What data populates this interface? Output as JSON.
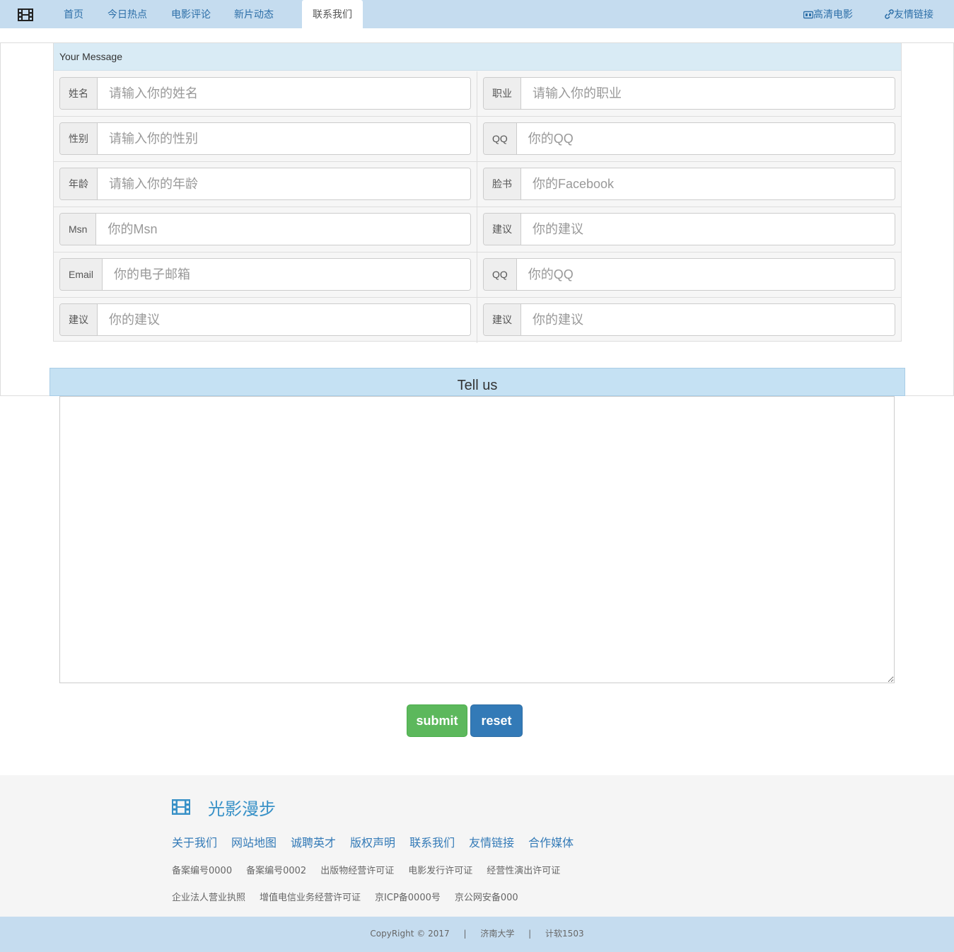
{
  "navbar": {
    "brand_icon": "film-icon",
    "items": [
      {
        "label": "首页"
      },
      {
        "label": "今日热点"
      },
      {
        "label": "电影评论"
      },
      {
        "label": "新片动态"
      },
      {
        "label": "联系我们",
        "active": true
      }
    ],
    "right": [
      {
        "label": "高清电影",
        "icon": "hd-video-icon"
      },
      {
        "label": "友情链接",
        "icon": "link-icon"
      }
    ]
  },
  "message_panel": {
    "heading": "Your Message",
    "rows": [
      {
        "left": {
          "label": "姓名",
          "placeholder": "请输入你的姓名"
        },
        "right": {
          "label": "职业",
          "placeholder": "请输入你的职业"
        }
      },
      {
        "left": {
          "label": "性别",
          "placeholder": "请输入你的性别"
        },
        "right": {
          "label": "QQ",
          "placeholder": "你的QQ"
        }
      },
      {
        "left": {
          "label": "年龄",
          "placeholder": "请输入你的年龄"
        },
        "right": {
          "label": "脸书",
          "placeholder": "你的Facebook"
        }
      },
      {
        "left": {
          "label": "Msn",
          "placeholder": "你的Msn"
        },
        "right": {
          "label": "建议",
          "placeholder": "你的建议"
        }
      },
      {
        "left": {
          "label": "Email",
          "placeholder": "你的电子邮箱"
        },
        "right": {
          "label": "QQ",
          "placeholder": "你的QQ"
        }
      },
      {
        "left": {
          "label": "建议",
          "placeholder": "你的建议"
        },
        "right": {
          "label": "建议",
          "placeholder": "你的建议"
        }
      }
    ]
  },
  "tell_us": {
    "heading": "Tell us",
    "value": ""
  },
  "buttons": {
    "submit": "submit",
    "reset": "reset"
  },
  "colors": {
    "navbar": "#c5dcef",
    "submit": "#5cb85c",
    "reset": "#337ab7",
    "link": "#337ab7"
  },
  "footer": {
    "logo_icon": "film-icon",
    "title": "光影漫步",
    "links": [
      "关于我们",
      "网站地图",
      "诚聘英才",
      "版权声明",
      "联系我们",
      "友情链接",
      "合作媒体"
    ],
    "row1": [
      "备案编号0000",
      "备案编号0002",
      "出版物经营许可证",
      "电影发行许可证",
      "经营性演出许可证"
    ],
    "row2": [
      "企业法人营业执照",
      "增值电信业务经营许可证",
      "京ICP备0000号",
      "京公网安备000"
    ]
  },
  "copyright": {
    "text": "CopyRight © 2017",
    "sep": "|",
    "school": "济南大学",
    "class": "计软1503"
  }
}
